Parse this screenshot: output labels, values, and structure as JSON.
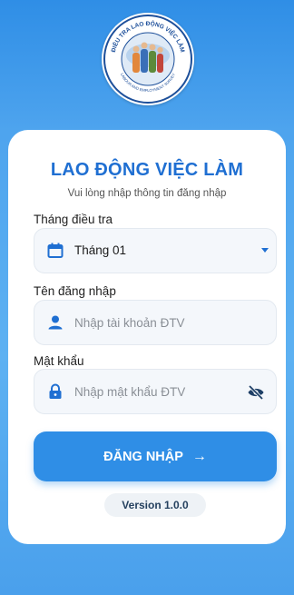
{
  "logo": {
    "arc_top_text": "ĐIỀU TRA LAO ĐỘNG VIỆC LÀM",
    "arc_bottom_text": "LABOUR AND EMPLOYMENT SURVEY"
  },
  "header": {
    "title": "LAO ĐỘNG VIỆC LÀM",
    "subtitle": "Vui lòng nhập thông tin đăng nhập"
  },
  "month_field": {
    "label": "Tháng điều tra",
    "value": "Tháng 01",
    "icon": "calendar-icon"
  },
  "username_field": {
    "label": "Tên đăng nhập",
    "placeholder": "Nhập tài khoản ĐTV",
    "icon": "person-icon"
  },
  "password_field": {
    "label": "Mật khẩu",
    "placeholder": "Nhập mật khẩu ĐTV",
    "icon": "lock-icon",
    "toggle_icon": "eye-off-icon"
  },
  "login_button": {
    "label": "ĐĂNG NHẬP",
    "arrow": "→"
  },
  "version": "Version 1.0.0",
  "colors": {
    "primary": "#2f8ee6",
    "title": "#1f6fd2",
    "background_top": "#2f8ee6",
    "background_bottom": "#5db1f2"
  }
}
